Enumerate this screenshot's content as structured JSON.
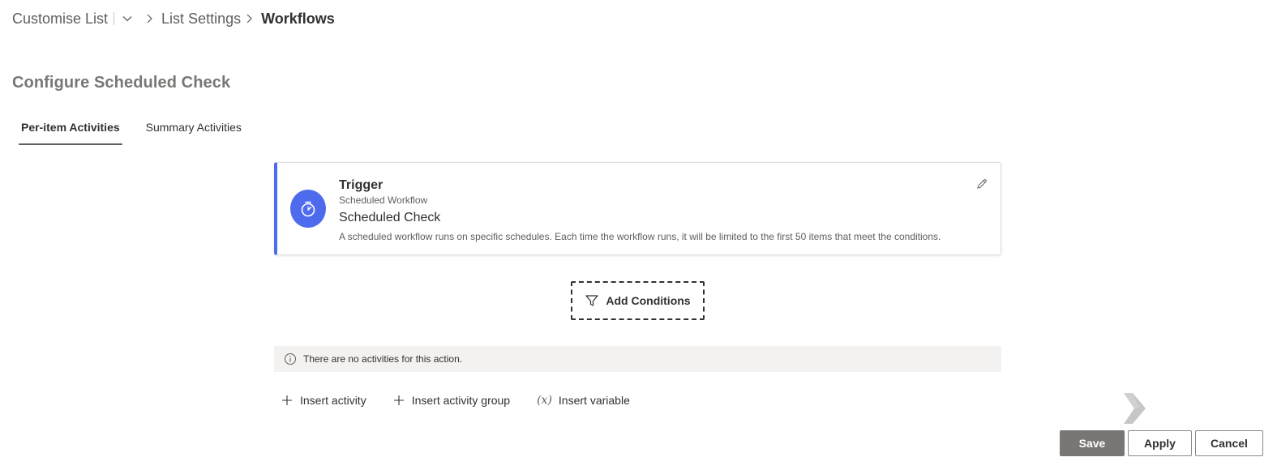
{
  "breadcrumb": {
    "items": [
      {
        "label": "Customise List"
      },
      {
        "label": "List Settings"
      },
      {
        "label": "Workflows"
      }
    ]
  },
  "page": {
    "title": "Configure Scheduled Check"
  },
  "tabs": [
    {
      "label": "Per-item Activities",
      "active": true
    },
    {
      "label": "Summary Activities",
      "active": false
    }
  ],
  "trigger": {
    "title": "Trigger",
    "subtitle": "Scheduled Workflow",
    "name": "Scheduled Check",
    "description": "A scheduled workflow runs on specific schedules. Each time the workflow runs, it will be limited to the first 50 items that meet the conditions.",
    "icon": "timer-icon",
    "accent_color": "#4f6bed"
  },
  "conditions": {
    "add_label": "Add Conditions"
  },
  "activities": {
    "empty_message": "There are no activities for this action."
  },
  "insert": {
    "activity_label": "Insert activity",
    "group_label": "Insert activity group",
    "variable_label": "Insert variable",
    "variable_glyph": "(x)"
  },
  "footer": {
    "save_label": "Save",
    "apply_label": "Apply",
    "cancel_label": "Cancel"
  },
  "colors": {
    "primary_button": "#797775",
    "info_bar_bg": "#f3f2f1"
  }
}
